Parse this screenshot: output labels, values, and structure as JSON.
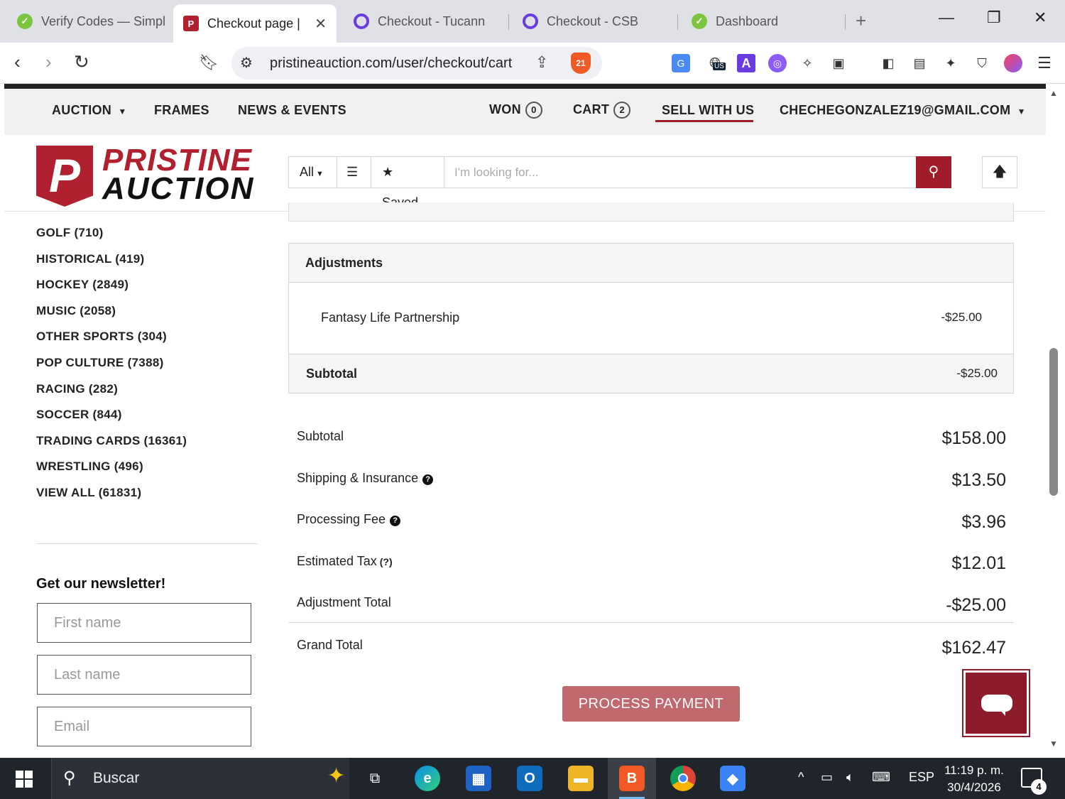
{
  "browser": {
    "tabs": [
      {
        "title": "Verify Codes — Simpl",
        "favicon": "green-check-icon"
      },
      {
        "title": "Checkout page |",
        "favicon": "pristine-p-icon",
        "active": true
      },
      {
        "title": "Checkout - Tucann",
        "favicon": "purple-ring-icon"
      },
      {
        "title": "Checkout - CSB",
        "favicon": "purple-ring-icon"
      },
      {
        "title": "Dashboard",
        "favicon": "green-check-icon"
      }
    ],
    "url": "pristineauction.com/user/checkout/cart",
    "brave_shield_count": "21",
    "vpn_region": "US"
  },
  "site": {
    "nav": {
      "auction": "AUCTION",
      "frames": "FRAMES",
      "news": "NEWS & EVENTS",
      "won": "WON",
      "won_count": "0",
      "cart": "CART",
      "cart_count": "2",
      "sell": "SELL WITH US",
      "account": "CHECHEGONZALEZ19@GMAIL.COM"
    },
    "logo": {
      "letter": "P",
      "line1": "PRISTINE",
      "line2": "AUCTION"
    },
    "search": {
      "scope": "All",
      "saved": "Saved",
      "placeholder": "I'm looking for..."
    }
  },
  "sidebar": {
    "categories": [
      "GOLF (710)",
      "HISTORICAL (419)",
      "HOCKEY (2849)",
      "MUSIC (2058)",
      "OTHER SPORTS (304)",
      "POP CULTURE (7388)",
      "RACING (282)",
      "SOCCER (844)",
      "TRADING CARDS (16361)",
      "WRESTLING (496)",
      "VIEW ALL (61831)"
    ],
    "newsletter": {
      "title": "Get our newsletter!",
      "first_name": "First name",
      "last_name": "Last name",
      "email": "Email"
    }
  },
  "adjustments": {
    "title": "Adjustments",
    "item_label": "Fantasy Life Partnership",
    "item_value": "-$25.00",
    "subtotal_label": "Subtotal",
    "subtotal_value": "-$25.00"
  },
  "summary": {
    "subtotal_label": "Subtotal",
    "subtotal_value": "$158.00",
    "shipping_label": "Shipping & Insurance",
    "shipping_value": "$13.50",
    "processing_label": "Processing Fee",
    "processing_value": "$3.96",
    "tax_label": "Estimated Tax",
    "tax_hint": "(?)",
    "tax_value": "$12.01",
    "adjustment_label": "Adjustment Total",
    "adjustment_value": "-$25.00",
    "grand_label": "Grand Total",
    "grand_value": "$162.47"
  },
  "actions": {
    "process_payment": "PROCESS PAYMENT"
  },
  "taskbar": {
    "search": "Buscar",
    "language": "ESP",
    "time": "11:19 p. m.",
    "date": "30/4/2026",
    "notifications": "4"
  },
  "colors": {
    "brand": "#a11c2b",
    "pay_button": "#c0696f",
    "nav_bg": "#f1f1f1",
    "taskbar": "#20242b"
  }
}
